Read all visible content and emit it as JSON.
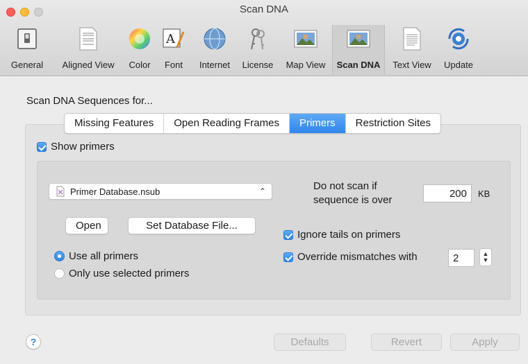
{
  "window": {
    "title": "Scan DNA"
  },
  "toolbar": {
    "items": [
      {
        "label": "General",
        "icon": "switch-icon"
      },
      {
        "label": "Aligned View",
        "icon": "document-icon"
      },
      {
        "label": "Color",
        "icon": "color-wheel-icon"
      },
      {
        "label": "Font",
        "icon": "font-icon"
      },
      {
        "label": "Internet",
        "icon": "globe-icon"
      },
      {
        "label": "License",
        "icon": "keys-icon"
      },
      {
        "label": "Map View",
        "icon": "photo-icon"
      },
      {
        "label": "Scan DNA",
        "icon": "photo-icon",
        "selected": true
      },
      {
        "label": "Text View",
        "icon": "text-document-icon"
      },
      {
        "label": "Update",
        "icon": "sync-icon"
      }
    ]
  },
  "main": {
    "section_title": "Scan DNA Sequences for...",
    "tabs": [
      "Missing Features",
      "Open Reading Frames",
      "Primers",
      "Restriction Sites"
    ],
    "active_tab": "Primers",
    "show_primers_label": "Show primers",
    "database_popup": {
      "value": "Primer Database.nsub"
    },
    "open_button": "Open",
    "set_db_button": "Set Database File...",
    "radios": {
      "use_all": "Use all primers",
      "only_selected": "Only use selected primers",
      "selected": "use_all"
    },
    "scan_limit": {
      "label_line1": "Do not scan if",
      "label_line2": "sequence is over",
      "value": "200",
      "unit": "KB"
    },
    "ignore_tails_label": "Ignore tails on primers",
    "override_label": "Override mismatches with",
    "override_value": "2"
  },
  "footer": {
    "help": "?",
    "defaults": "Defaults",
    "revert": "Revert",
    "apply": "Apply"
  },
  "colors": {
    "accent": "#2f86ec",
    "window_bg": "#ececec"
  }
}
